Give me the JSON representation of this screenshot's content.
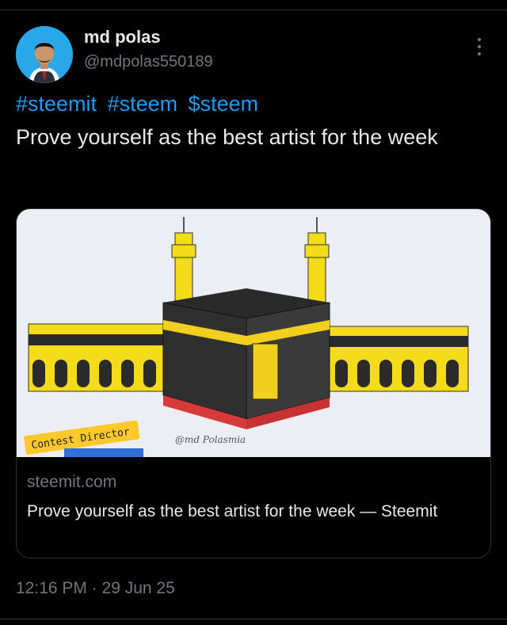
{
  "tweet": {
    "author_name": "md polas",
    "author_handle": "@mdpolas550189",
    "hashtags": [
      "#steemit",
      "#steem",
      "$steem"
    ],
    "text": "Prove yourself as the best artist for the week",
    "timestamp": "12:16 PM · 29 Jun 25"
  },
  "card": {
    "domain": "steemit.com",
    "title": "Prove yourself as the best artist for the week — Steemit",
    "image": {
      "badge": "Contest Director",
      "signature": "@md Polasmia"
    }
  },
  "icons": {
    "more": "more-vertical-icon",
    "avatar": "avatar-photo"
  },
  "colors": {
    "link": "#1d9bf0",
    "muted": "#71767b",
    "text": "#e7e9ea",
    "background": "#000000"
  }
}
